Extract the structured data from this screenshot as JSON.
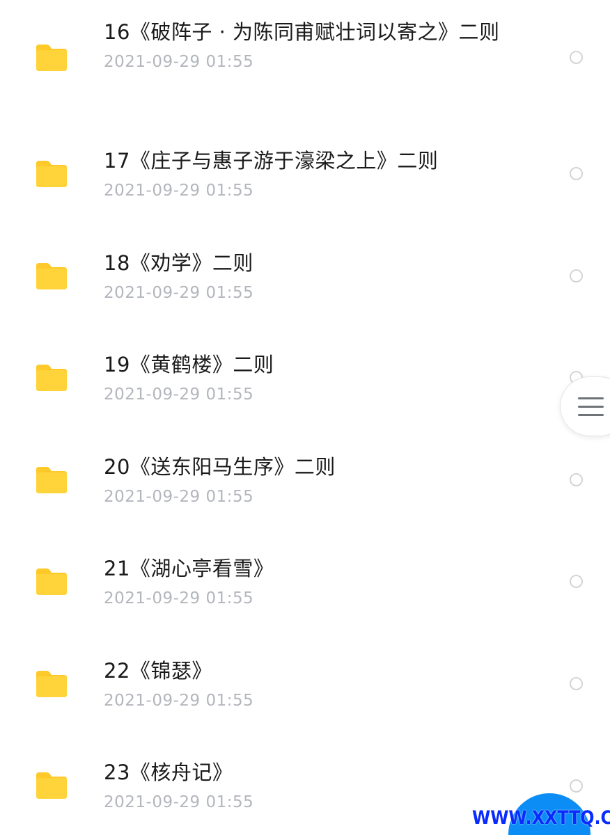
{
  "file_list": {
    "items": [
      {
        "name": "16《破阵子 · 为陈同甫赋壮词以寄之》二则",
        "date": "2021-09-29 01:55"
      },
      {
        "name": "17《庄子与惠子游于濠梁之上》二则",
        "date": "2021-09-29 01:55"
      },
      {
        "name": "18《劝学》二则",
        "date": "2021-09-29 01:55"
      },
      {
        "name": "19《黄鹤楼》二则",
        "date": "2021-09-29 01:55"
      },
      {
        "name": "20《送东阳马生序》二则",
        "date": "2021-09-29 01:55"
      },
      {
        "name": "21《湖心亭看雪》",
        "date": "2021-09-29 01:55"
      },
      {
        "name": "22《锦瑟》",
        "date": "2021-09-29 01:55"
      },
      {
        "name": "23《核舟记》",
        "date": "2021-09-29 01:55"
      }
    ]
  },
  "icons": {
    "folder": "folder-icon",
    "select": "radio-circle-icon",
    "menu": "hamburger-menu-icon"
  },
  "colors": {
    "folder": "#FFD43B",
    "folder_tab": "#FFC929",
    "name_text": "#1A1A1A",
    "date_text": "#B3B6BC",
    "fab": "#0B8DF5",
    "watermark": "#0A2BFF"
  },
  "watermark": {
    "text": "WWW.XXTTQ.COM"
  }
}
